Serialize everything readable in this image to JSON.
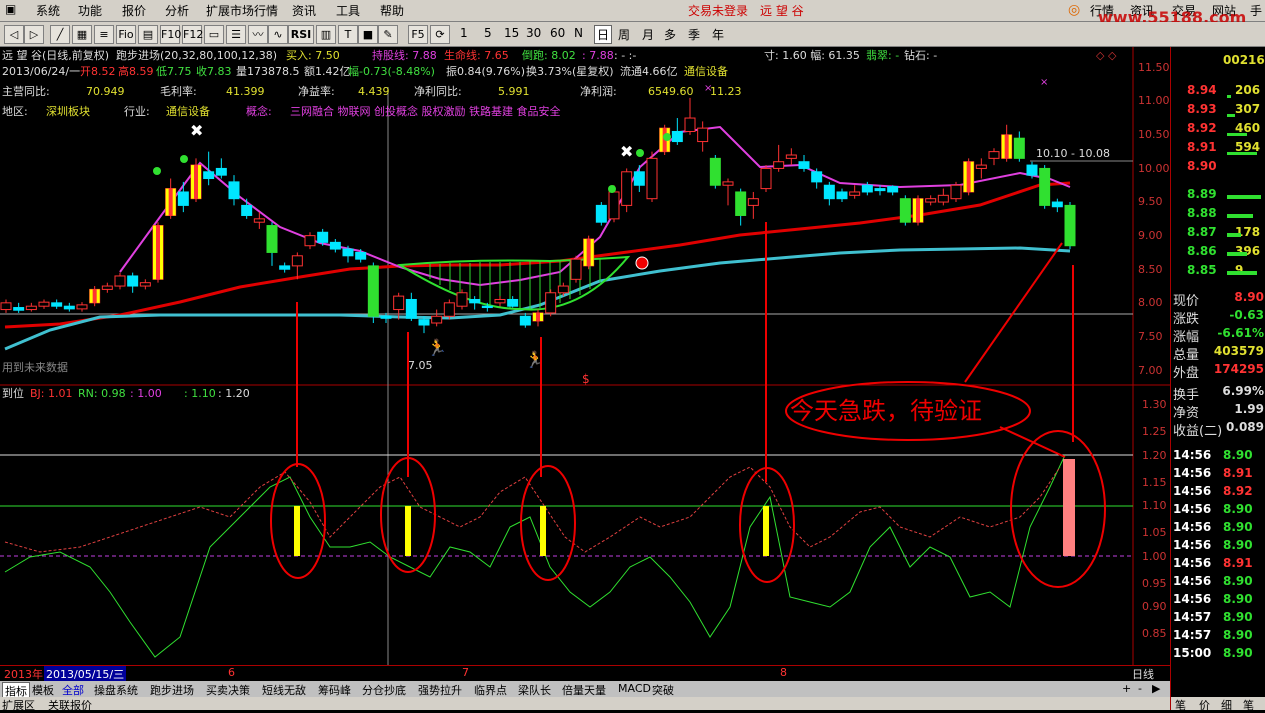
{
  "menu": {
    "items": [
      "系统",
      "功能",
      "报价",
      "分析",
      "扩展市场行情",
      "资讯",
      "工具",
      "帮助"
    ],
    "login_status": "交易未登录",
    "stock_name": "远 望 谷",
    "right_tabs": [
      "行情",
      "资讯",
      "交易",
      "网站",
      "手"
    ],
    "watermark": "www.55188.com"
  },
  "toolbar": {
    "periods": [
      "1",
      "5",
      "15",
      "30",
      "60",
      "N",
      "日",
      "周",
      "月",
      "多",
      "季",
      "年"
    ],
    "buttons": [
      "RSI",
      "F5"
    ]
  },
  "header": {
    "line1_stock": "远 望 谷(日线,前复权)",
    "line1_indicator": "跑步进场(20,32,80,100,12,38)",
    "line1_buy": "买入: 7.50",
    "line1_hold": "持股线: 7.88",
    "line1_life": "生命线: 7.65",
    "line1_run": "倒跑: 8.02",
    "line1_run2": ": 7.88",
    "line1_dots": ": - :-",
    "line1_right": "寸: 1.60  幅: 61.35",
    "line1_jade": "翡翠: -",
    "line1_diamond": "钻石: -",
    "line2": "2013/06/24/一",
    "line2_open": "开8.52",
    "line2_high": "高8.59",
    "line2_low": "低7.75",
    "line2_close": "收7.83",
    "line2_vol": "量173878.5",
    "line2_amt": "额1.42亿",
    "line2_chg": "幅-0.73(-8.48%)",
    "line2_amp": "振0.84(9.76%)",
    "line2_turn": "换3.73%(星复权)",
    "line2_float": "流通4.66亿",
    "line2_sector": "通信设备",
    "line3": [
      {
        "k": "主营同比:",
        "v": "70.949"
      },
      {
        "k": "毛利率:",
        "v": "41.399"
      },
      {
        "k": "净益率:",
        "v": "4.439"
      },
      {
        "k": "净利同比:",
        "v": "5.991"
      },
      {
        "k": "净利润:",
        "v": "6549.60"
      },
      {
        "k": "",
        "v": "11.23"
      }
    ],
    "line4": {
      "area_k": "地区:",
      "area_v": "深圳板块",
      "ind_k": "行业:",
      "ind_v": "通信设备",
      "concept_k": "概念:",
      "concept_v": "三网融合 物联网 创投概念 股权激励 铁路基建 食品安全"
    }
  },
  "annotations": {
    "range_label": "10.10 - 10.08",
    "low_label": "7.05",
    "future_data": "用到未来数据",
    "sub_label": "到位",
    "bj": "BJ: 1.01",
    "rn": "RN: 0.98",
    "v1": ": 1.00",
    "v2": ": 1.10",
    "v3": ": 1.20",
    "callout": "今天急跌，待验证"
  },
  "price_axis": [
    "11.50",
    "11.00",
    "10.50",
    "10.00",
    "9.50",
    "9.00",
    "8.50",
    "8.00",
    "7.50",
    "7.00"
  ],
  "sub_axis": [
    "1.30",
    "1.25",
    "1.20",
    "1.15",
    "1.10",
    "1.05",
    "1.00",
    "0.95",
    "0.90",
    "0.85"
  ],
  "time_axis": {
    "year": "2013年",
    "date": "2013/05/15/三",
    "months": [
      "6",
      "7",
      "8"
    ],
    "period": "日线"
  },
  "bottom_tabs": [
    "指标",
    "模板",
    "全部",
    "操盘系统",
    "跑步进场",
    "买卖决策",
    "短线无敌",
    "筹码峰",
    "分仓抄底",
    "强势拉升",
    "临界点",
    "梁队长",
    "倍量天量",
    "MACD",
    "突破"
  ],
  "status": {
    "left": "扩展区",
    "left2": "关联报价"
  },
  "right_panel": {
    "code": "00216",
    "asks": [
      {
        "p": "8.94",
        "v": "206"
      },
      {
        "p": "8.93",
        "v": "307"
      },
      {
        "p": "8.92",
        "v": "460"
      },
      {
        "p": "8.91",
        "v": "594"
      },
      {
        "p": "8.90",
        "v": ""
      }
    ],
    "bids": [
      {
        "p": "8.89",
        "v": ""
      },
      {
        "p": "8.88",
        "v": ""
      },
      {
        "p": "8.87",
        "v": "178"
      },
      {
        "p": "8.86",
        "v": "396"
      },
      {
        "p": "8.85",
        "v": "9"
      }
    ],
    "stats": [
      {
        "k": "现价",
        "v": "8.90"
      },
      {
        "k": "涨跌",
        "v": "-0.63"
      },
      {
        "k": "涨幅",
        "v": "-6.61%"
      },
      {
        "k": "总量",
        "v": "403579"
      },
      {
        "k": "外盘",
        "v": "174295"
      },
      {
        "k": "换手",
        "v": "6.99%"
      },
      {
        "k": "净资",
        "v": "1.99"
      },
      {
        "k": "收益(二)",
        "v": "0.089"
      }
    ],
    "ticks": [
      {
        "t": "14:56",
        "p": "8.90"
      },
      {
        "t": "14:56",
        "p": "8.91"
      },
      {
        "t": "14:56",
        "p": "8.92"
      },
      {
        "t": "14:56",
        "p": "8.90"
      },
      {
        "t": "14:56",
        "p": "8.90"
      },
      {
        "t": "14:56",
        "p": "8.90"
      },
      {
        "t": "14:56",
        "p": "8.91"
      },
      {
        "t": "14:56",
        "p": "8.90"
      },
      {
        "t": "14:56",
        "p": "8.90"
      },
      {
        "t": "14:57",
        "p": "8.90"
      },
      {
        "t": "14:57",
        "p": "8.90"
      },
      {
        "t": "15:00",
        "p": "8.90"
      }
    ],
    "bottom": [
      "笔",
      "价",
      "细",
      "笔"
    ]
  },
  "colors": {
    "up": "#ff3232",
    "down": "#00e6ff",
    "ma_red": "#e00000",
    "ma_magenta": "#e040e0",
    "ma_cyan": "#40c0d0",
    "ma_green": "#30e030",
    "highlight": "#ffff00",
    "signal_bar": "#ff8080"
  }
}
